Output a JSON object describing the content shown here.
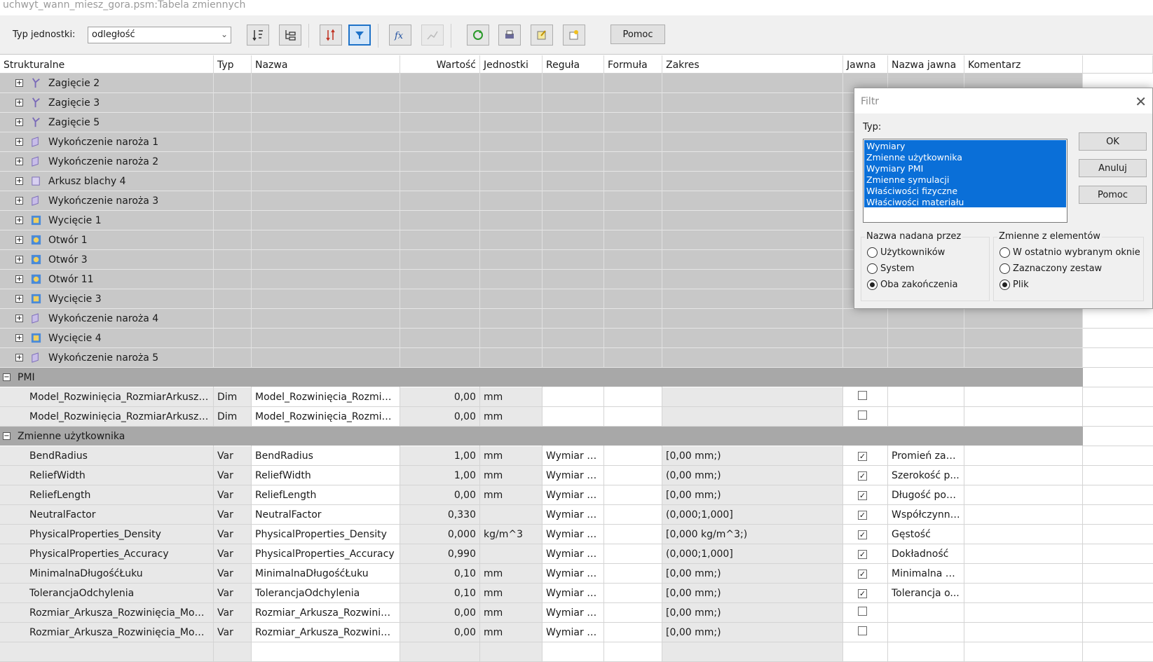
{
  "window": {
    "title": "uchwyt_wann_miesz_gora.psm:Tabela zmiennych"
  },
  "toolbar": {
    "unit_type_label": "Typ jednostki:",
    "unit_type_value": "odległość",
    "help_label": "Pomoc",
    "buttons": [
      "sort-icon",
      "tree-icon",
      "sort-order-icon",
      "filter-icon",
      "formula-icon",
      "chart-icon",
      "refresh-icon",
      "print-icon",
      "edit-icon",
      "bulb-icon"
    ]
  },
  "columns": [
    "Strukturalne",
    "Typ",
    "Nazwa",
    "Wartość",
    "Jednostki",
    "Reguła",
    "Formuła",
    "Zakres",
    "Jawna",
    "Nazwa jawna",
    "Komentarz"
  ],
  "features": [
    {
      "label": "Zagięcie 2",
      "icon": "bend-icon"
    },
    {
      "label": "Zagięcie 3",
      "icon": "bend-icon"
    },
    {
      "label": "Zagięcie 5",
      "icon": "bend-icon"
    },
    {
      "label": "Wykończenie naroża 1",
      "icon": "corner-icon"
    },
    {
      "label": "Wykończenie naroża 2",
      "icon": "corner-icon"
    },
    {
      "label": "Arkusz blachy 4",
      "icon": "sheet-icon"
    },
    {
      "label": "Wykończenie naroża 3",
      "icon": "corner-icon"
    },
    {
      "label": "Wycięcie 1",
      "icon": "cutout-icon"
    },
    {
      "label": "Otwór 1",
      "icon": "hole-icon"
    },
    {
      "label": "Otwór 3",
      "icon": "hole-icon"
    },
    {
      "label": "Otwór 11",
      "icon": "hole-icon"
    },
    {
      "label": "Wycięcie 3",
      "icon": "cutout-icon"
    },
    {
      "label": "Wykończenie naroża 4",
      "icon": "corner-icon"
    },
    {
      "label": "Wycięcie 4",
      "icon": "cutout-icon"
    },
    {
      "label": "Wykończenie naroża 5",
      "icon": "corner-icon"
    }
  ],
  "groups": {
    "pmi": {
      "label": "PMI",
      "rows": [
        {
          "struct": "Model_Rozwinięcia_RozmiarArkuszaX",
          "typ": "Dim",
          "nazwa": "Model_Rozwinięcia_RozmiarArkuszaX",
          "wartosc": "0,00",
          "jednostki": "mm",
          "regula": "",
          "formula": "",
          "zakres": "",
          "jawna": false,
          "nazwa_jawna": "",
          "komentarz": ""
        },
        {
          "struct": "Model_Rozwinięcia_RozmiarArkuszaY",
          "typ": "Dim",
          "nazwa": "Model_Rozwinięcia_RozmiarArkuszaY",
          "wartosc": "0,00",
          "jednostki": "mm",
          "regula": "",
          "formula": "",
          "zakres": "",
          "jawna": false,
          "nazwa_jawna": "",
          "komentarz": ""
        }
      ]
    },
    "user": {
      "label": "Zmienne użytkownika",
      "rows": [
        {
          "struct": "BendRadius",
          "typ": "Var",
          "nazwa": "BendRadius",
          "wartosc": "1,00",
          "jednostki": "mm",
          "regula": "Wymiar g...",
          "formula": "",
          "zakres": "[0,00 mm;)",
          "jawna": true,
          "nazwa_jawna": "Promień zagi...",
          "komentarz": ""
        },
        {
          "struct": "ReliefWidth",
          "typ": "Var",
          "nazwa": "ReliefWidth",
          "wartosc": "1,00",
          "jednostki": "mm",
          "regula": "Wymiar g...",
          "formula": "",
          "zakres": "(0,00 mm;)",
          "jawna": true,
          "nazwa_jawna": "Szerokość p...",
          "komentarz": ""
        },
        {
          "struct": "ReliefLength",
          "typ": "Var",
          "nazwa": "ReliefLength",
          "wartosc": "0,00",
          "jednostki": "mm",
          "regula": "Wymiar g...",
          "formula": "",
          "zakres": "[0,00 mm;)",
          "jawna": true,
          "nazwa_jawna": "Długość pod...",
          "komentarz": ""
        },
        {
          "struct": "NeutralFactor",
          "typ": "Var",
          "nazwa": "NeutralFactor",
          "wartosc": "0,330",
          "jednostki": "",
          "regula": "Wymiar g...",
          "formula": "",
          "zakres": "(0,000;1,000]",
          "jawna": true,
          "nazwa_jawna": "Współczynni...",
          "komentarz": ""
        },
        {
          "struct": "PhysicalProperties_Density",
          "typ": "Var",
          "nazwa": "PhysicalProperties_Density",
          "wartosc": "0,000",
          "jednostki": "kg/m^3",
          "regula": "Wymiar g...",
          "formula": "",
          "zakres": "[0,000 kg/m^3;)",
          "jawna": true,
          "nazwa_jawna": "Gęstość",
          "komentarz": ""
        },
        {
          "struct": "PhysicalProperties_Accuracy",
          "typ": "Var",
          "nazwa": "PhysicalProperties_Accuracy",
          "wartosc": "0,990",
          "jednostki": "",
          "regula": "Wymiar g...",
          "formula": "",
          "zakres": "(0,000;1,000]",
          "jawna": true,
          "nazwa_jawna": "Dokładność",
          "komentarz": ""
        },
        {
          "struct": "MinimalnaDługośćŁuku",
          "typ": "Var",
          "nazwa": "MinimalnaDługośćŁuku",
          "wartosc": "0,10",
          "jednostki": "mm",
          "regula": "Wymiar g...",
          "formula": "",
          "zakres": "[0,00 mm;)",
          "jawna": true,
          "nazwa_jawna": "Minimalna dł...",
          "komentarz": ""
        },
        {
          "struct": "TolerancjaOdchylenia",
          "typ": "Var",
          "nazwa": "TolerancjaOdchylenia",
          "wartosc": "0,10",
          "jednostki": "mm",
          "regula": "Wymiar g...",
          "formula": "",
          "zakres": "[0,00 mm;)",
          "jawna": true,
          "nazwa_jawna": "Tolerancja o...",
          "komentarz": ""
        },
        {
          "struct": "Rozmiar_Arkusza_Rozwinięcia_Model_X",
          "typ": "Var",
          "nazwa": "Rozmiar_Arkusza_Rozwinięcia_Model_X",
          "wartosc": "0,00",
          "jednostki": "mm",
          "regula": "Wymiar g...",
          "formula": "",
          "zakres": "[0,00 mm;)",
          "jawna": false,
          "nazwa_jawna": "",
          "komentarz": ""
        },
        {
          "struct": "Rozmiar_Arkusza_Rozwinięcia_Model_Y",
          "typ": "Var",
          "nazwa": "Rozmiar_Arkusza_Rozwinięcia_Model_Y",
          "wartosc": "0,00",
          "jednostki": "mm",
          "regula": "Wymiar g...",
          "formula": "",
          "zakres": "[0,00 mm;)",
          "jawna": false,
          "nazwa_jawna": "",
          "komentarz": ""
        }
      ]
    }
  },
  "dialog": {
    "title": "Filtr",
    "typ_label": "Typ:",
    "type_list": [
      "Wymiary",
      "Zmienne użytkownika",
      "Wymiary PMI",
      "Zmienne symulacji",
      "Właściwości fizyczne",
      "Właściwości materiału"
    ],
    "ok_label": "OK",
    "cancel_label": "Anuluj",
    "help_label": "Pomoc",
    "named_by": {
      "title": "Nazwa nadana przez",
      "options": [
        "Użytkowników",
        "System",
        "Oba zakończenia"
      ],
      "selected": 2
    },
    "vars_from": {
      "title": "Zmienne z elementów",
      "options": [
        "W ostatnio wybranym oknie",
        "Zaznaczony zestaw",
        "Plik"
      ],
      "selected": 2
    }
  },
  "colors": {
    "selection": "#0a6fd8",
    "feature_row": "#c8c8c8",
    "group_row": "#a8a8a8"
  }
}
